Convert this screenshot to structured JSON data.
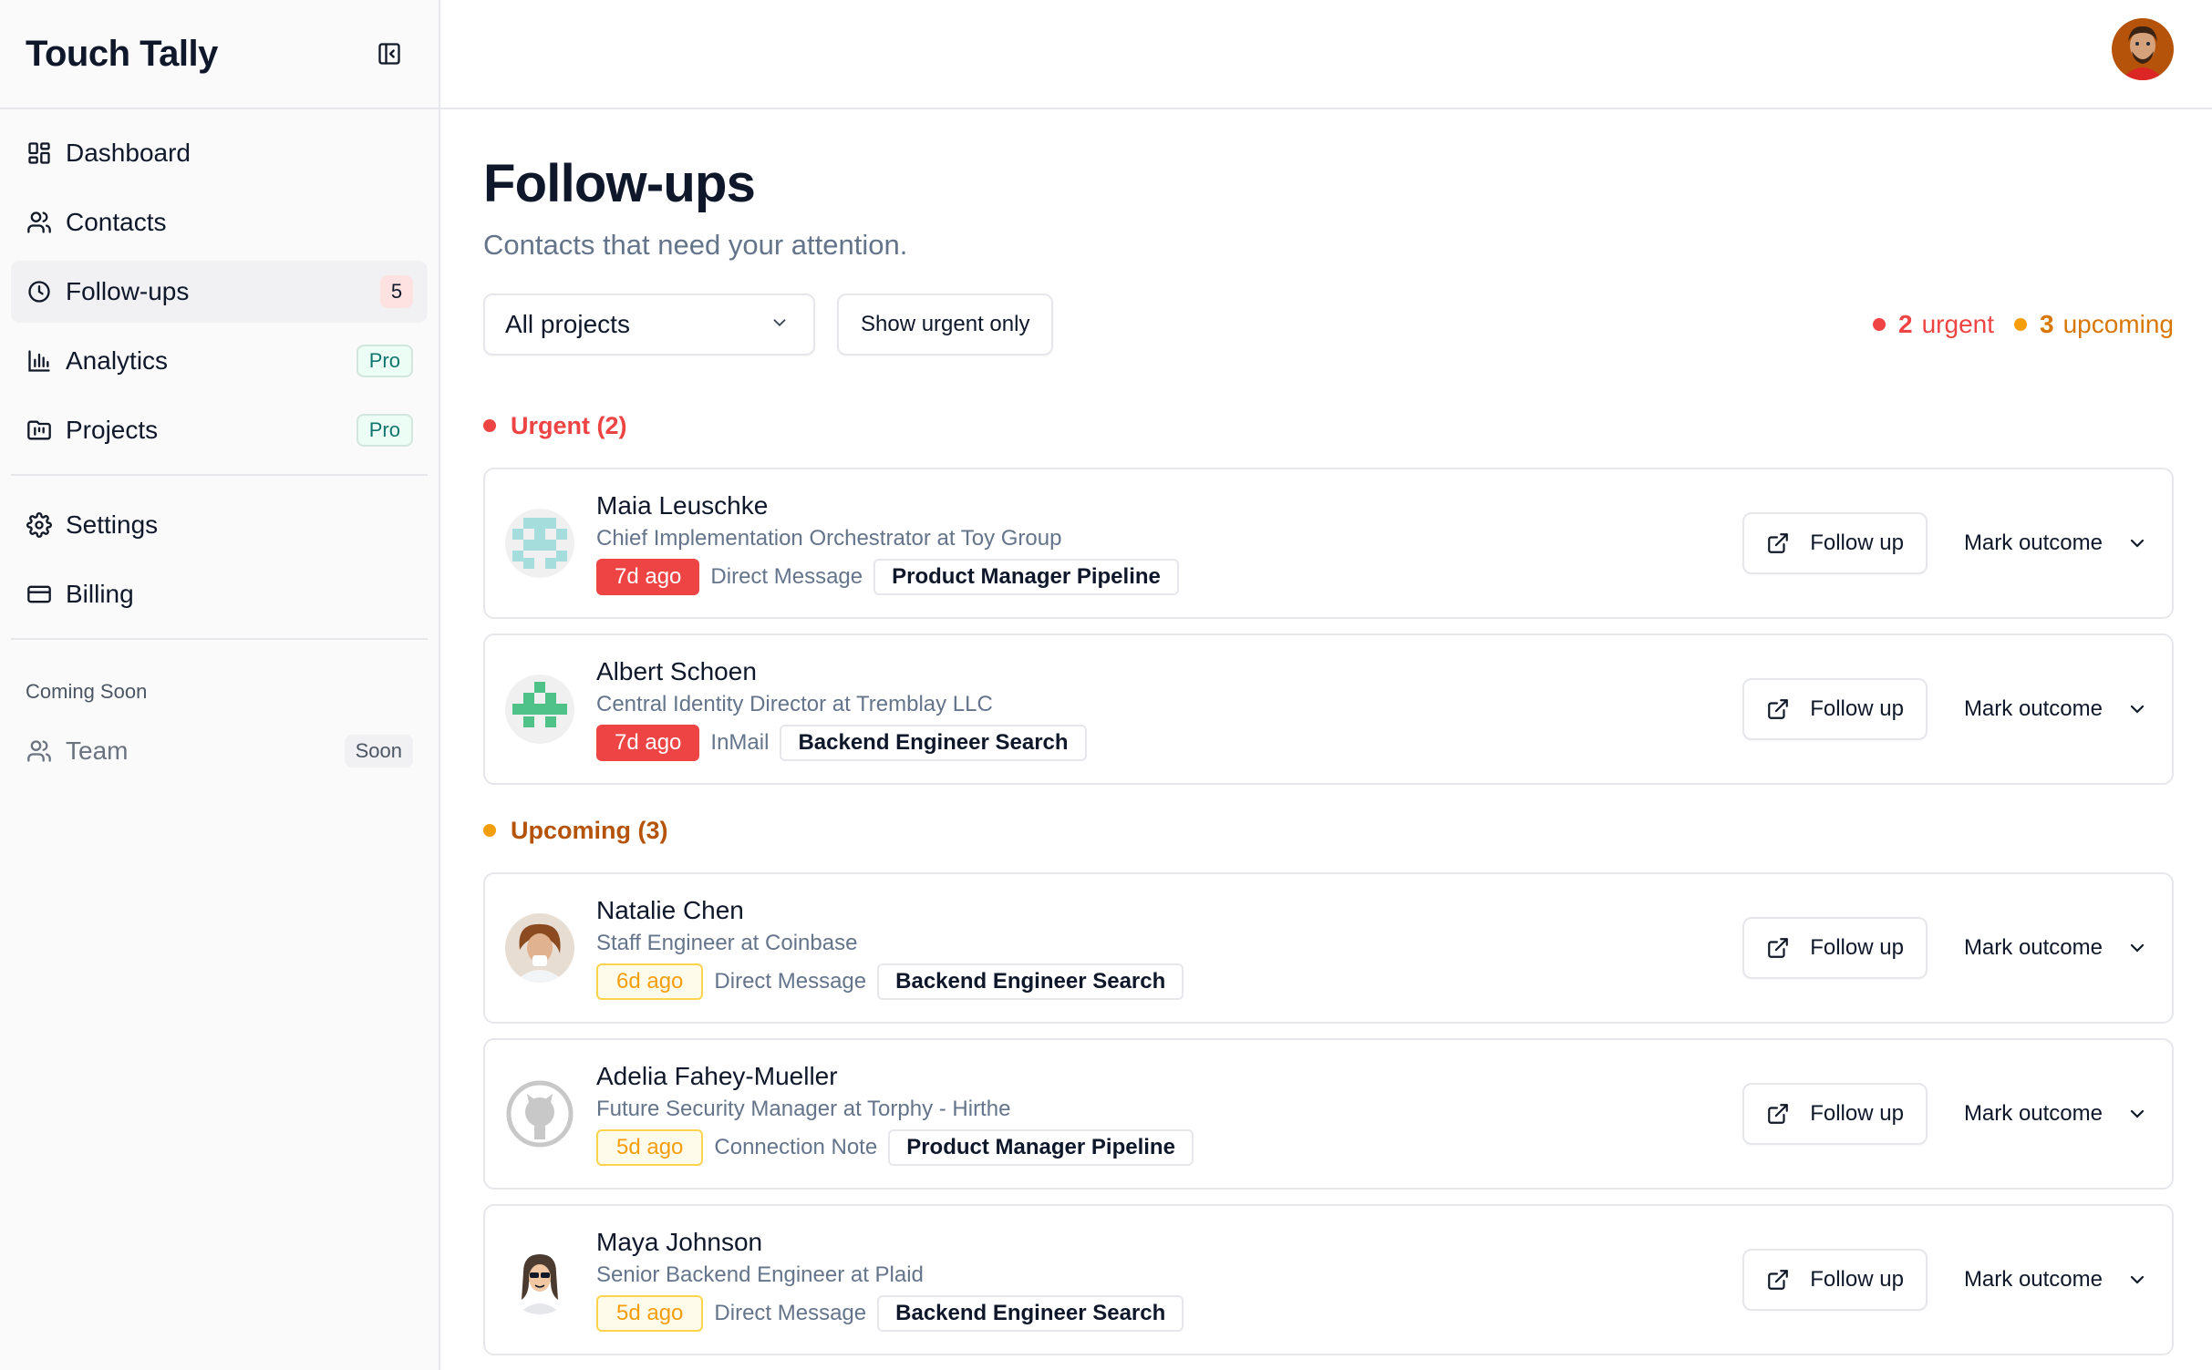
{
  "app": {
    "title": "Touch Tally"
  },
  "sidebar": {
    "items": [
      {
        "label": "Dashboard",
        "icon": "dashboard-icon"
      },
      {
        "label": "Contacts",
        "icon": "users-icon"
      },
      {
        "label": "Follow-ups",
        "icon": "clock-icon",
        "badge": "5",
        "active": true
      },
      {
        "label": "Analytics",
        "icon": "bar-chart-icon",
        "badge": "Pro"
      },
      {
        "label": "Projects",
        "icon": "folder-kanban-icon",
        "badge": "Pro"
      }
    ],
    "secondary": [
      {
        "label": "Settings",
        "icon": "gear-icon"
      },
      {
        "label": "Billing",
        "icon": "credit-card-icon"
      }
    ],
    "coming_soon": {
      "label": "Coming Soon",
      "items": [
        {
          "label": "Team",
          "icon": "users-icon",
          "badge": "Soon"
        }
      ]
    }
  },
  "page": {
    "title": "Follow-ups",
    "subtitle": "Contacts that need your attention."
  },
  "filters": {
    "project_select": "All projects",
    "urgent_toggle": "Show urgent only"
  },
  "summary": {
    "urgent_count": "2",
    "urgent_label": "urgent",
    "upcoming_count": "3",
    "upcoming_label": "upcoming"
  },
  "colors": {
    "urgent": "#ef4444",
    "upcoming": "#f59e0b",
    "upcoming_text": "#b45309"
  },
  "actions": {
    "follow_up": "Follow up",
    "mark_outcome": "Mark outcome"
  },
  "groups": {
    "urgent": {
      "title": "Urgent (2)",
      "contacts": [
        {
          "name": "Maia Leuschke",
          "role": "Chief Implementation Orchestrator at Toy Group",
          "age": "7d ago",
          "channel": "Direct Message",
          "project": "Product Manager Pipeline",
          "avatar": "identicon-teal"
        },
        {
          "name": "Albert Schoen",
          "role": "Central Identity Director at Tremblay LLC",
          "age": "7d ago",
          "channel": "InMail",
          "project": "Backend Engineer Search",
          "avatar": "identicon-green"
        }
      ]
    },
    "upcoming": {
      "title": "Upcoming (3)",
      "contacts": [
        {
          "name": "Natalie Chen",
          "role": "Staff Engineer at Coinbase",
          "age": "6d ago",
          "channel": "Direct Message",
          "project": "Backend Engineer Search",
          "avatar": "photo-avatar"
        },
        {
          "name": "Adelia Fahey-Mueller",
          "role": "Future Security Manager at Torphy - Hirthe",
          "age": "5d ago",
          "channel": "Connection Note",
          "project": "Product Manager Pipeline",
          "avatar": "github-avatar"
        },
        {
          "name": "Maya Johnson",
          "role": "Senior Backend Engineer at Plaid",
          "age": "5d ago",
          "channel": "Direct Message",
          "project": "Backend Engineer Search",
          "avatar": "illustrated-avatar"
        }
      ]
    }
  }
}
